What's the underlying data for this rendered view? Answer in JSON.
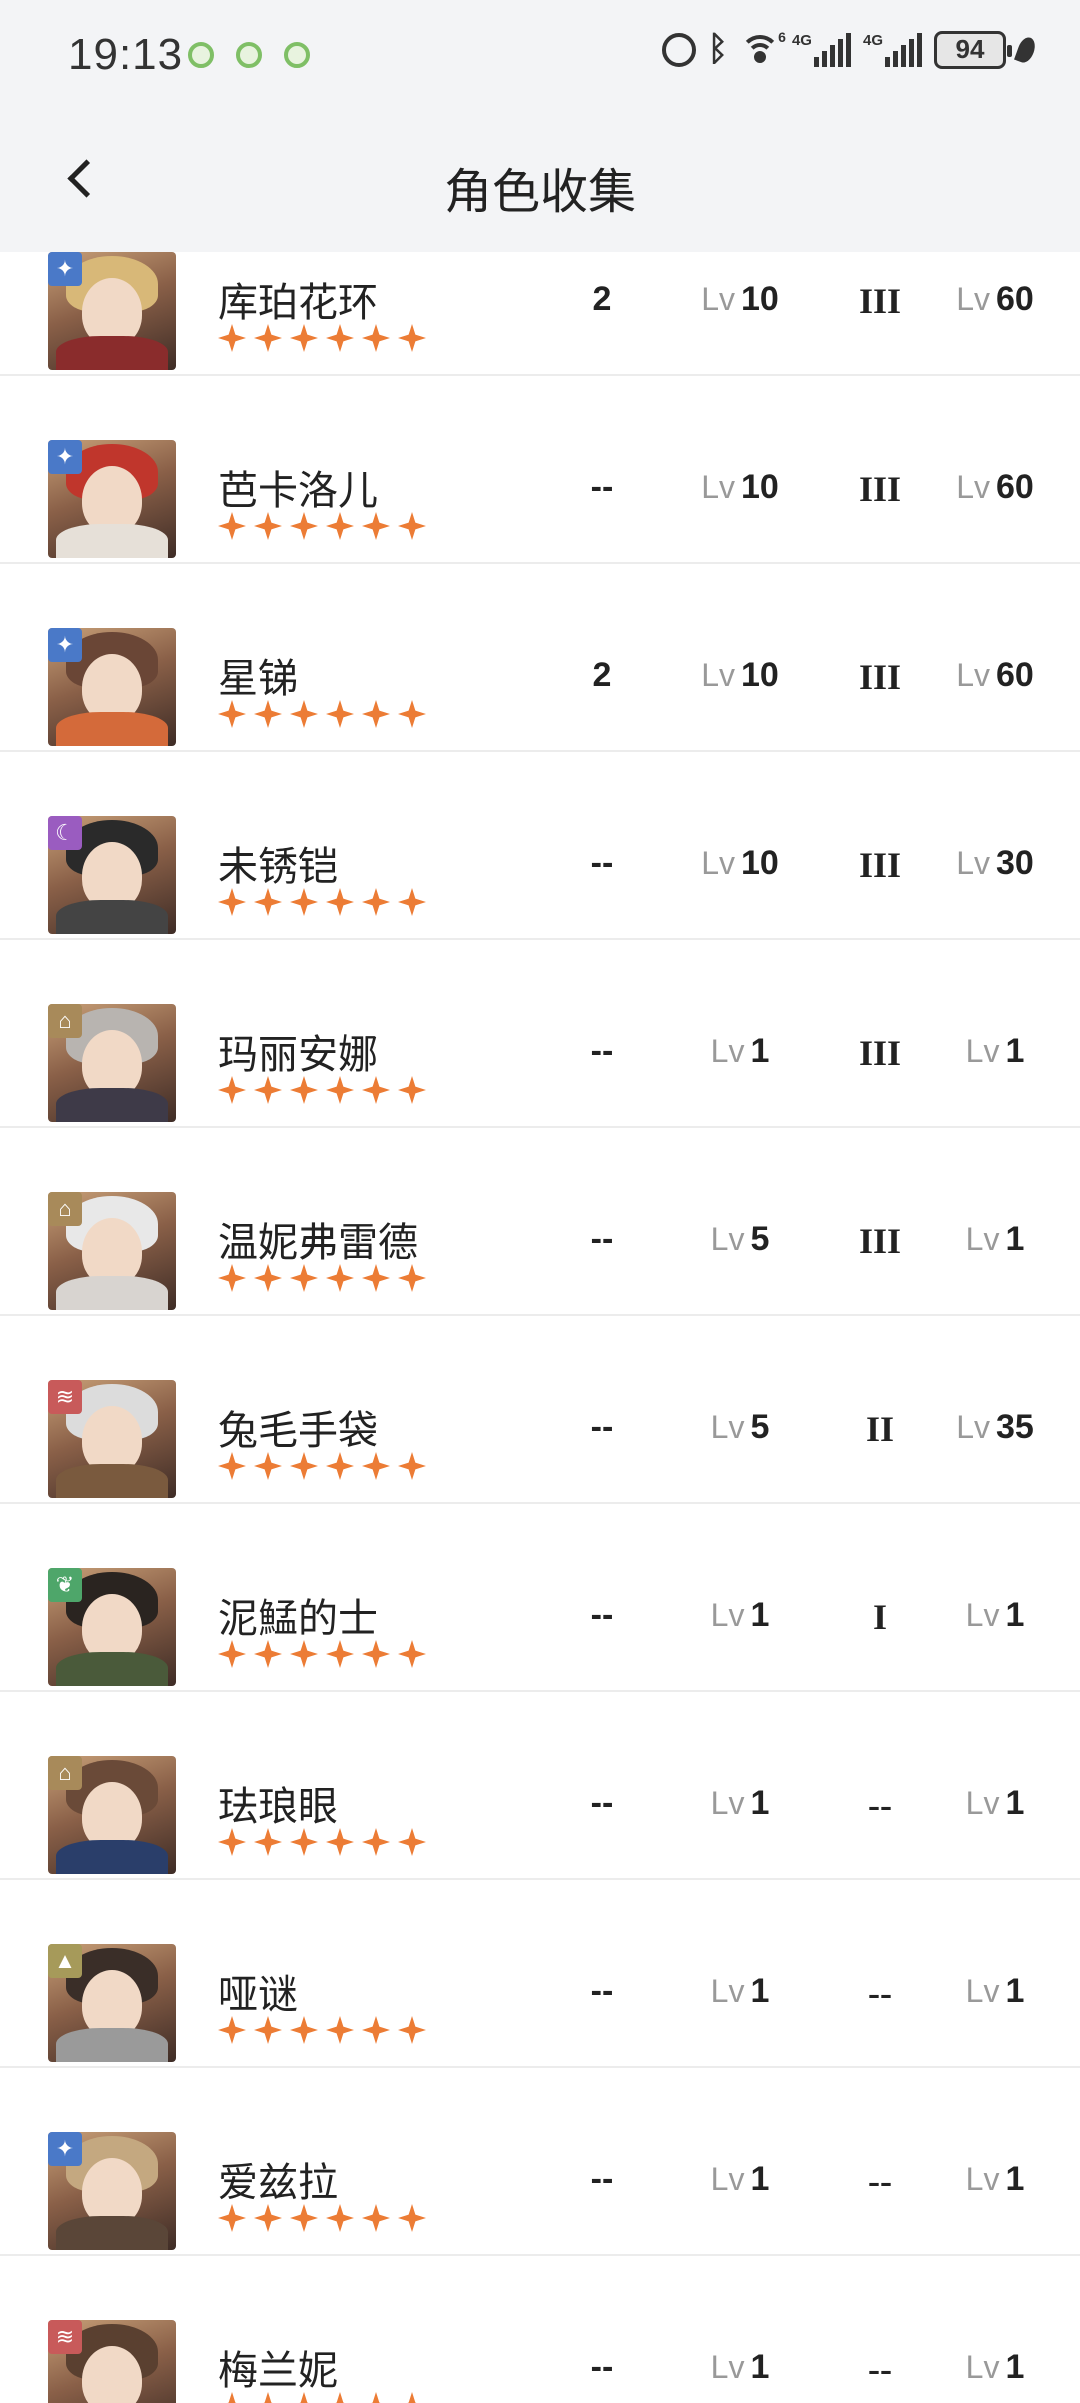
{
  "status_bar": {
    "time": "19:13",
    "battery": "94",
    "network_1": "4G",
    "network_2": "4G",
    "wifi_badge": "6"
  },
  "nav": {
    "title": "角色收集"
  },
  "lv_prefix": "Lv",
  "colors": {
    "accent_star": "#ec7c35",
    "badge_blue": "#4a79c8",
    "badge_purple": "#9a5cc0",
    "badge_gold": "#a88a5a",
    "badge_red": "#c85a5a",
    "badge_green": "#4ea66a",
    "badge_olive": "#a69a5a"
  },
  "characters": [
    {
      "name": "库珀花环",
      "stars": 6,
      "dupes": "2",
      "level": "10",
      "insight": "III",
      "skill_level": "60",
      "badge_icon": "star-compass-icon",
      "badge_color": "#4a79c8",
      "hair": "#d8b878",
      "outfit": "#8a2c2c"
    },
    {
      "name": "芭卡洛儿",
      "stars": 6,
      "dupes": "--",
      "level": "10",
      "insight": "III",
      "skill_level": "60",
      "badge_icon": "star-compass-icon",
      "badge_color": "#4a79c8",
      "hair": "#c0362c",
      "outfit": "#e6e0d8"
    },
    {
      "name": "星锑",
      "stars": 6,
      "dupes": "2",
      "level": "10",
      "insight": "III",
      "skill_level": "60",
      "badge_icon": "star-compass-icon",
      "badge_color": "#4a79c8",
      "hair": "#6a4636",
      "outfit": "#d46a3a"
    },
    {
      "name": "未锈铠",
      "stars": 6,
      "dupes": "--",
      "level": "10",
      "insight": "III",
      "skill_level": "30",
      "badge_icon": "moon-icon",
      "badge_color": "#9a5cc0",
      "hair": "#2a2a2a",
      "outfit": "#444444"
    },
    {
      "name": "玛丽安娜",
      "stars": 6,
      "dupes": "--",
      "level": "1",
      "insight": "III",
      "skill_level": "1",
      "badge_icon": "tower-icon",
      "badge_color": "#a88a5a",
      "hair": "#b8b4b0",
      "outfit": "#3e3a48"
    },
    {
      "name": "温妮弗雷德",
      "stars": 6,
      "dupes": "--",
      "level": "5",
      "insight": "III",
      "skill_level": "1",
      "badge_icon": "tower-icon",
      "badge_color": "#a88a5a",
      "hair": "#e8e8e8",
      "outfit": "#d8d4d0"
    },
    {
      "name": "兔毛手袋",
      "stars": 6,
      "dupes": "--",
      "level": "5",
      "insight": "II",
      "skill_level": "35",
      "badge_icon": "claw-icon",
      "badge_color": "#c85a5a",
      "hair": "#dcdcdc",
      "outfit": "#7a5a3e"
    },
    {
      "name": "泥鯭的士",
      "stars": 6,
      "dupes": "--",
      "level": "1",
      "insight": "I",
      "skill_level": "1",
      "badge_icon": "leaf-icon",
      "badge_color": "#4ea66a",
      "hair": "#2a2420",
      "outfit": "#4a5a3a"
    },
    {
      "name": "珐琅眼",
      "stars": 6,
      "dupes": "--",
      "level": "1",
      "insight": "--",
      "skill_level": "1",
      "badge_icon": "tower-icon",
      "badge_color": "#a88a5a",
      "hair": "#6a4a38",
      "outfit": "#2a3e6a"
    },
    {
      "name": "哑谜",
      "stars": 6,
      "dupes": "--",
      "level": "1",
      "insight": "--",
      "skill_level": "1",
      "badge_icon": "pyramid-icon",
      "badge_color": "#a69a5a",
      "hair": "#3a2e28",
      "outfit": "#9a9a9a"
    },
    {
      "name": "爱兹拉",
      "stars": 6,
      "dupes": "--",
      "level": "1",
      "insight": "--",
      "skill_level": "1",
      "badge_icon": "star-compass-icon",
      "badge_color": "#4a79c8",
      "hair": "#c4a880",
      "outfit": "#5a4638"
    },
    {
      "name": "梅兰妮",
      "stars": 6,
      "dupes": "--",
      "level": "1",
      "insight": "--",
      "skill_level": "1",
      "badge_icon": "claw-icon",
      "badge_color": "#c85a5a",
      "hair": "#5a4030",
      "outfit": "#c8a888"
    }
  ]
}
